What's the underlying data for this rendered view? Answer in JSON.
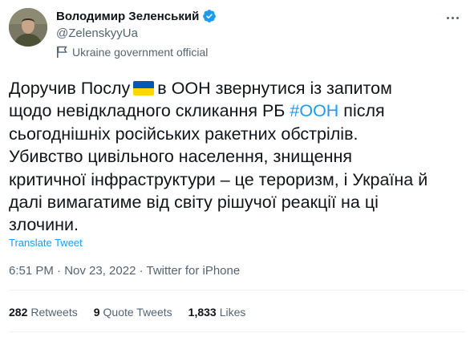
{
  "author": {
    "display_name": "Володимир Зеленський",
    "handle": "@ZelenskyyUa",
    "verified": true,
    "label": "Ukraine government official"
  },
  "tweet": {
    "lines": [
      [
        "Доручив Послу",
        "FLAG",
        "в ООН звернутися із запитом"
      ],
      [
        "щодо невідкладного скликання РБ ",
        "#ООН",
        " після"
      ],
      [
        "сьогоднішніх російських ракетних обстрілів."
      ],
      [
        "Убивство цивільного населення, знищення"
      ],
      [
        "критичної інфраструктури – це тероризм, і Україна й"
      ],
      [
        "далі вимагатиме від світу рішучої реакції на ці"
      ],
      [
        "злочини."
      ]
    ],
    "line1_before": "Доручив Послу",
    "line1_after": "в ООН звернутися із запитом",
    "line2_before": "щодо невідкладного скликання РБ ",
    "line2_hashtag": "#ООН",
    "line2_after": " після",
    "line3": "сьогоднішніх російських ракетних обстрілів.",
    "line4": "Убивство цивільного населення, знищення",
    "line5": "критичної інфраструктури – це тероризм, і Україна й",
    "line6": "далі вимагатиме від світу рішучої реакції на ці",
    "line7": "злочини.",
    "translate": "Translate Tweet",
    "timestamp": "6:51 PM · Nov 23, 2022 · Twitter for iPhone"
  },
  "stats": {
    "retweets_count": "282",
    "retweets_label": "Retweets",
    "quotes_count": "9",
    "quotes_label": "Quote Tweets",
    "likes_count": "1,833",
    "likes_label": "Likes"
  },
  "icons": {
    "verified": "verified-badge-icon",
    "government": "flag-label-icon",
    "more": "more-icon"
  },
  "colors": {
    "link": "#1d9bf0",
    "secondary": "#536471",
    "primary": "#0f1419",
    "flag_blue": "#0057b7",
    "flag_yellow": "#ffd700"
  }
}
